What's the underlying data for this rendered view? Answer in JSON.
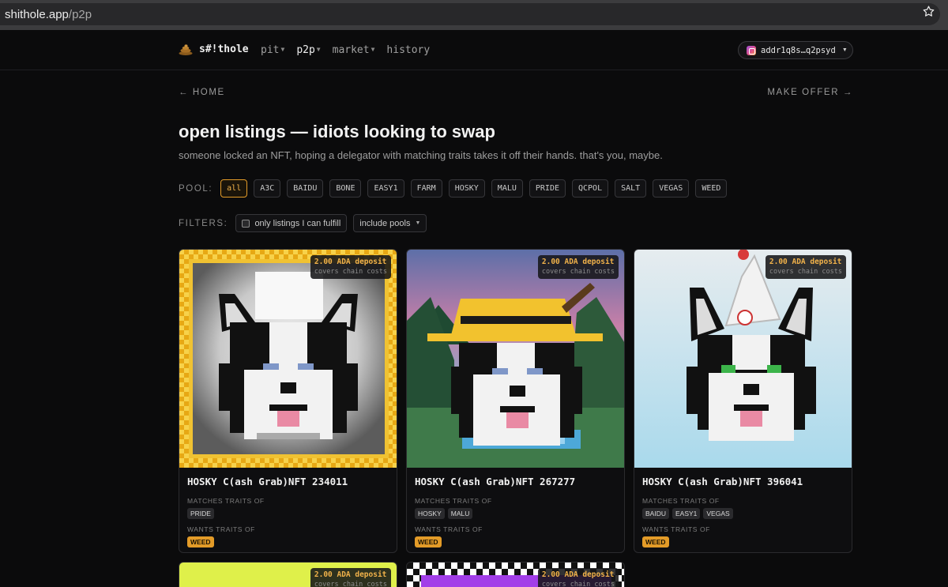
{
  "browser": {
    "url_host": "shithole.app",
    "url_path": "/p2p"
  },
  "nav": {
    "logo": "s#!thole",
    "links": [
      {
        "label": "pit",
        "caret": "▼"
      },
      {
        "label": "p2p",
        "caret": "▼"
      },
      {
        "label": "market",
        "caret": "▼"
      },
      {
        "label": "history",
        "caret": ""
      }
    ],
    "wallet": "addr1q8s…q2psyd"
  },
  "page": {
    "home_link": "← HOME",
    "offer_link": "MAKE OFFER →",
    "title": "open listings — idiots looking to swap",
    "subtitle": "someone locked an NFT, hoping a delegator with matching traits takes it off their hands. that's you, maybe."
  },
  "pool": {
    "label": "POOL:",
    "options": [
      "all",
      "A3C",
      "BAIDU",
      "BONE",
      "EASY1",
      "FARM",
      "HOSKY",
      "MALU",
      "PRIDE",
      "QCPOL",
      "SALT",
      "VEGAS",
      "WEED"
    ],
    "selected": "all"
  },
  "filters": {
    "label": "FILTERS:",
    "fulfill_label": "only listings I can fulfill",
    "fulfill_checked": false,
    "pools_dropdown": "include pools"
  },
  "listings": [
    {
      "title": "HOSKY C(ash Grab)NFT 234011",
      "deposit": "2.00 ADA deposit",
      "deposit_note": "covers chain costs",
      "matches_label": "MATCHES TRAITS OF",
      "matches": [
        "PRIDE"
      ],
      "wants_label": "WANTS TRAITS OF",
      "wants": [
        "WEED"
      ]
    },
    {
      "title": "HOSKY C(ash Grab)NFT 267277",
      "deposit": "2.00 ADA deposit",
      "deposit_note": "covers chain costs",
      "matches_label": "MATCHES TRAITS OF",
      "matches": [
        "HOSKY",
        "MALU"
      ],
      "wants_label": "WANTS TRAITS OF",
      "wants": [
        "WEED"
      ]
    },
    {
      "title": "HOSKY C(ash Grab)NFT 396041",
      "deposit": "2.00 ADA deposit",
      "deposit_note": "covers chain costs",
      "matches_label": "MATCHES TRAITS OF",
      "matches": [
        "BAIDU",
        "EASY1",
        "VEGAS"
      ],
      "wants_label": "WANTS TRAITS OF",
      "wants": [
        "WEED"
      ]
    },
    {
      "title": "",
      "deposit": "2.00 ADA deposit",
      "deposit_note": "covers chain costs"
    },
    {
      "title": "",
      "deposit": "2.00 ADA deposit",
      "deposit_note": "covers chain costs"
    }
  ],
  "colors": {
    "accent": "#e39b28",
    "background": "#0b0b0c"
  }
}
